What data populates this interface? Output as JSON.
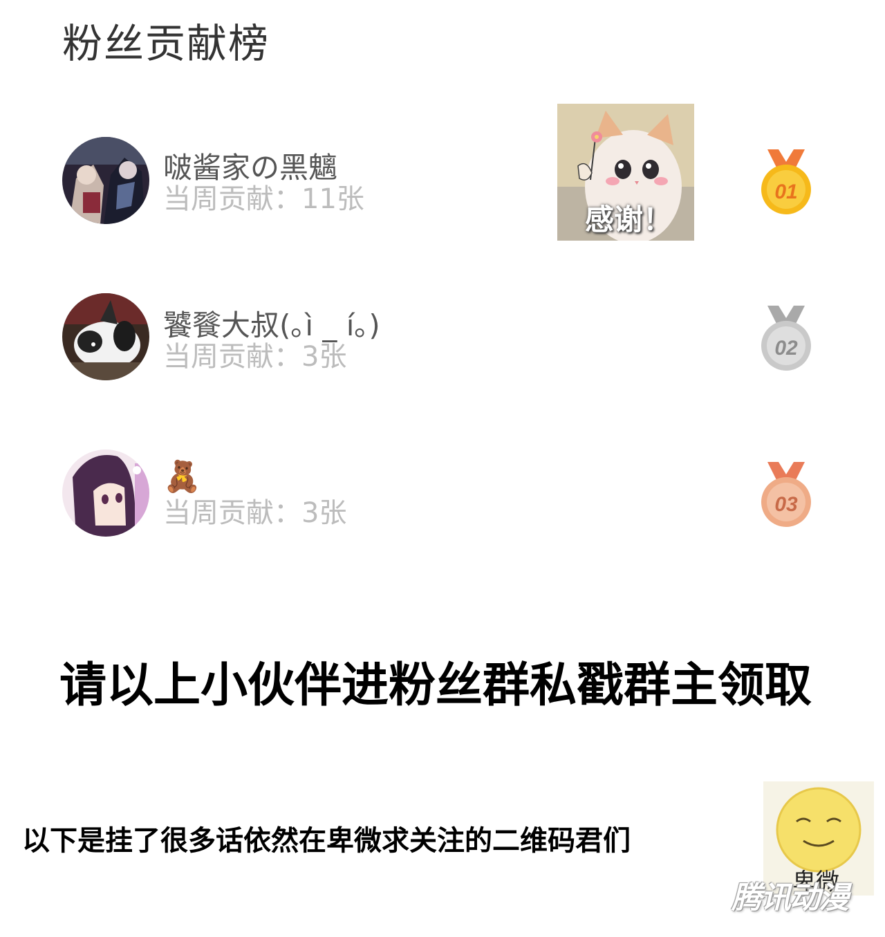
{
  "page_title": "粉丝贡献榜",
  "ranking": [
    {
      "rank": 1,
      "name": "啵酱家の黑魑",
      "contribution": "当周贡献：11张",
      "medal_number": "01",
      "medal_color": "#f6b91a"
    },
    {
      "rank": 2,
      "name": "饕餮大叔(｡ì _ í｡)",
      "contribution": "当周贡献：3张",
      "medal_number": "02",
      "medal_color": "#c9c9c9"
    },
    {
      "rank": 3,
      "name": "🧸",
      "contribution": "当周贡献：3张",
      "medal_number": "03",
      "medal_color": "#efab86"
    }
  ],
  "thanks_sticker": {
    "text": "感谢！",
    "icon": "cat-holding-flower-sticker"
  },
  "notice": "请以上小伙伴进粉丝群私戳群主领取",
  "sub_notice": "以下是挂了很多话依然在卑微求关注的二维码君们",
  "face_sticker": {
    "text": "卑微",
    "icon": "humble-smiley-face-sticker"
  },
  "watermark": "腾讯动漫"
}
